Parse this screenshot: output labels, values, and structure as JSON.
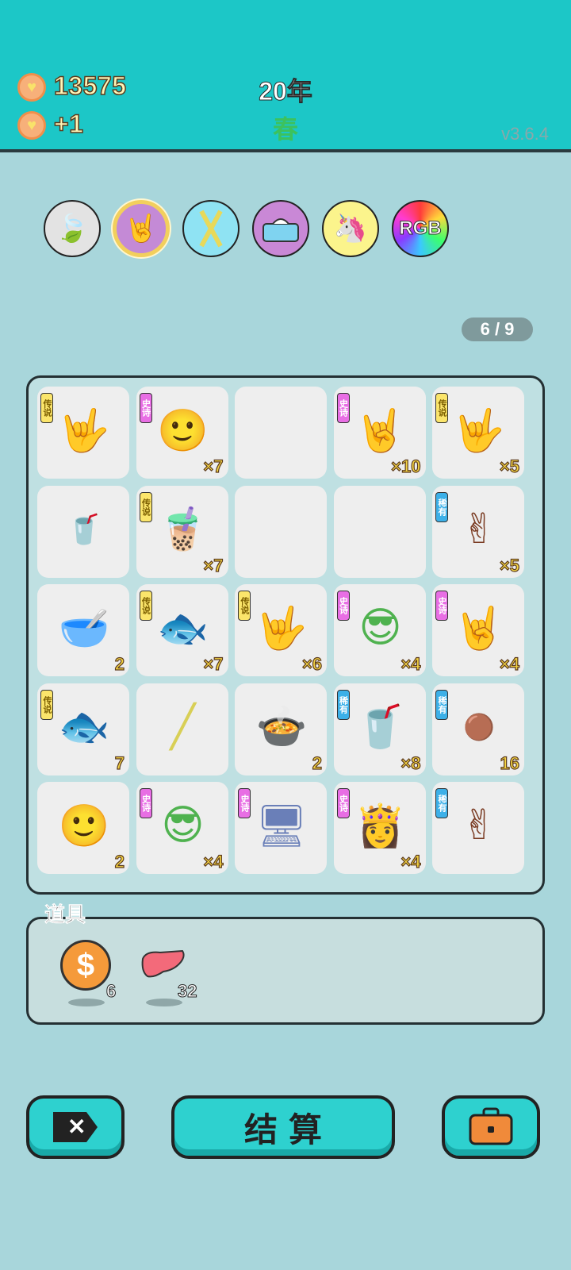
{
  "header": {
    "coins": "13575",
    "income": "+1",
    "year": "20年",
    "season": "春",
    "version": "v3.6.4"
  },
  "categories": [
    {
      "name": "leaf-icon",
      "selected": false,
      "bg": "#e3e3e3"
    },
    {
      "name": "rock-hand-icon",
      "selected": true,
      "bg": "#c48ad6"
    },
    {
      "name": "straws-icon",
      "selected": false,
      "bg": "#8fe3f3"
    },
    {
      "name": "tissue-box-icon",
      "selected": false,
      "bg": "#c988d6"
    },
    {
      "name": "unicorn-icon",
      "selected": false,
      "bg": "#fbf48c"
    },
    {
      "name": "rgb-icon",
      "selected": false,
      "bg": "#ffffff"
    }
  ],
  "pager": "6 / 9",
  "rarity_labels": {
    "legend": "传说",
    "epic": "史诗",
    "rare": "稀有"
  },
  "grid": [
    {
      "icon": "yellow-hand-icon",
      "rarity": "legend",
      "count": ""
    },
    {
      "icon": "bald-face-icon",
      "rarity": "epic",
      "count": "×7"
    },
    {
      "icon": "",
      "rarity": "",
      "count": ""
    },
    {
      "icon": "gray-hand-icon",
      "rarity": "epic",
      "count": "×10"
    },
    {
      "icon": "yellow-hand-icon",
      "rarity": "legend",
      "count": "×5"
    },
    {
      "icon": "small-cup-icon",
      "rarity": "",
      "count": ""
    },
    {
      "icon": "bubble-tea-icon",
      "rarity": "legend",
      "count": "×7"
    },
    {
      "icon": "",
      "rarity": "",
      "count": ""
    },
    {
      "icon": "",
      "rarity": "",
      "count": ""
    },
    {
      "icon": "brown-hand-icon",
      "rarity": "rare",
      "count": "×5"
    },
    {
      "icon": "bowl-icon",
      "rarity": "",
      "count": "2"
    },
    {
      "icon": "koi-fish-icon",
      "rarity": "legend",
      "count": "×7"
    },
    {
      "icon": "yellow-hand-moon-icon",
      "rarity": "legend",
      "count": "×6"
    },
    {
      "icon": "green-hair-face-icon",
      "rarity": "epic",
      "count": "×4"
    },
    {
      "icon": "gray-hand-icon",
      "rarity": "epic",
      "count": "×4"
    },
    {
      "icon": "koi-fish-icon",
      "rarity": "legend",
      "count": "7"
    },
    {
      "icon": "straw-icon",
      "rarity": "",
      "count": ""
    },
    {
      "icon": "soup-bowl-icon",
      "rarity": "",
      "count": "2"
    },
    {
      "icon": "tall-cup-icon",
      "rarity": "rare",
      "count": "×8"
    },
    {
      "icon": "pearl-star-icon",
      "rarity": "rare",
      "count": "16"
    },
    {
      "icon": "man-face-icon",
      "rarity": "",
      "count": "2"
    },
    {
      "icon": "green-hair-face-icon",
      "rarity": "epic",
      "count": "×4"
    },
    {
      "icon": "gpu-card-icon",
      "rarity": "epic",
      "count": ""
    },
    {
      "icon": "princess-icon",
      "rarity": "epic",
      "count": "×4"
    },
    {
      "icon": "brown-hand-icon",
      "rarity": "rare",
      "count": ""
    }
  ],
  "tools": {
    "title": "道具",
    "items": [
      {
        "icon": "dollar-coin-icon",
        "count": "6"
      },
      {
        "icon": "liver-icon",
        "count": "32"
      }
    ]
  },
  "buttons": {
    "settle": "结算"
  },
  "colors": {
    "header": "#1cc7c7",
    "background": "#a8d6db",
    "button": "#2ed1cf",
    "count_text": "#f5d542"
  }
}
